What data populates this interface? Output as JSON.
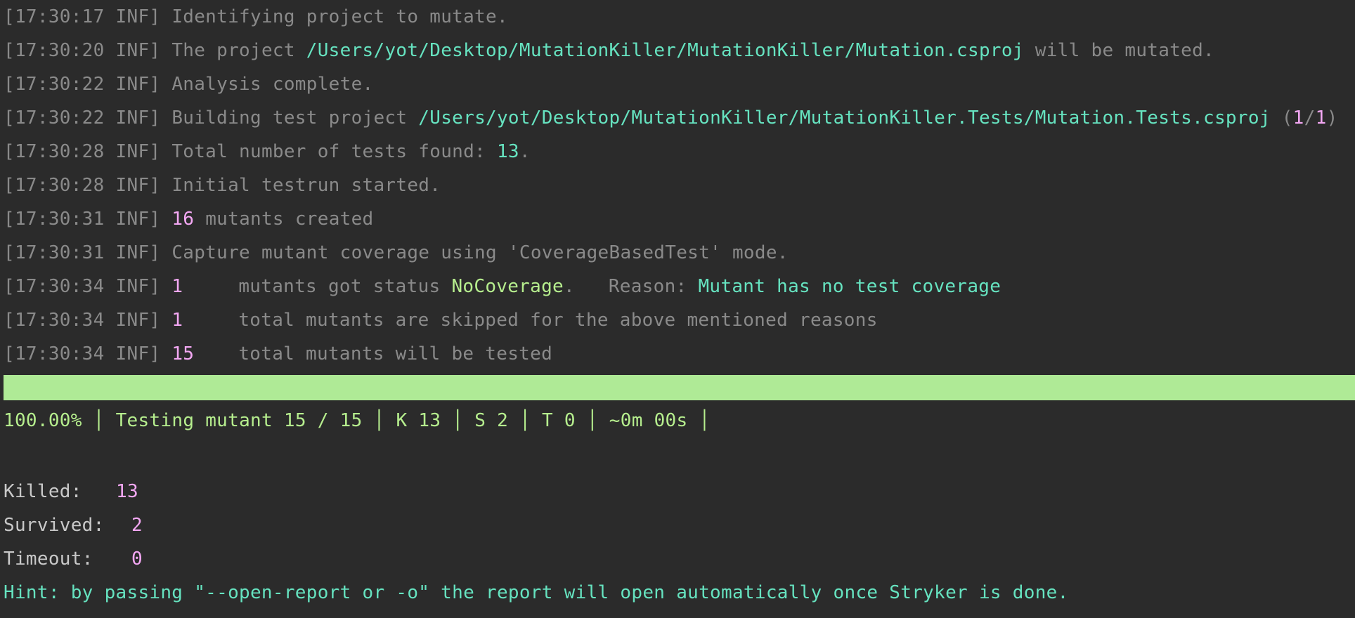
{
  "log": [
    {
      "ts": "[17:30:17 INF]",
      "parts": [
        {
          "t": " Identifying project to mutate.",
          "c": "gray"
        }
      ]
    },
    {
      "ts": "[17:30:20 INF]",
      "parts": [
        {
          "t": " The project ",
          "c": "gray"
        },
        {
          "t": "/Users/yot/Desktop/MutationKiller/MutationKiller/Mutation.csproj",
          "c": "teal"
        },
        {
          "t": " will be mutated.",
          "c": "gray"
        }
      ]
    },
    {
      "ts": "[17:30:22 INF]",
      "parts": [
        {
          "t": " Analysis complete.",
          "c": "gray"
        }
      ]
    },
    {
      "ts": "[17:30:22 INF]",
      "parts": [
        {
          "t": " Building test project ",
          "c": "gray"
        },
        {
          "t": "/Users/yot/Desktop/MutationKiller/MutationKiller.Tests/Mutation.Tests.csproj",
          "c": "teal"
        },
        {
          "t": " (",
          "c": "gray"
        },
        {
          "t": "1",
          "c": "pink"
        },
        {
          "t": "/",
          "c": "gray"
        },
        {
          "t": "1",
          "c": "pink"
        },
        {
          "t": ")",
          "c": "gray"
        }
      ]
    },
    {
      "ts": "[17:30:28 INF]",
      "parts": [
        {
          "t": " Total number of tests found: ",
          "c": "gray"
        },
        {
          "t": "13",
          "c": "teal"
        },
        {
          "t": ".",
          "c": "gray"
        }
      ]
    },
    {
      "ts": "[17:30:28 INF]",
      "parts": [
        {
          "t": " Initial testrun started.",
          "c": "gray"
        }
      ]
    },
    {
      "ts": "[17:30:31 INF]",
      "parts": [
        {
          "t": " ",
          "c": "gray"
        },
        {
          "t": "16",
          "c": "pink"
        },
        {
          "t": " mutants created",
          "c": "gray"
        }
      ]
    },
    {
      "ts": "[17:30:31 INF]",
      "parts": [
        {
          "t": " Capture mutant coverage using 'CoverageBasedTest' mode.",
          "c": "gray"
        }
      ]
    },
    {
      "ts": "[17:30:34 INF]",
      "parts": [
        {
          "t": " ",
          "c": "gray"
        },
        {
          "t": "1",
          "c": "pink",
          "pad": true
        },
        {
          "t": "mutants got status ",
          "c": "gray"
        },
        {
          "t": "NoCoverage",
          "c": "lime"
        },
        {
          "t": ".   Reason: ",
          "c": "gray"
        },
        {
          "t": "Mutant has no test coverage",
          "c": "teal"
        }
      ]
    },
    {
      "ts": "[17:30:34 INF]",
      "parts": [
        {
          "t": " ",
          "c": "gray"
        },
        {
          "t": "1",
          "c": "pink",
          "pad": true
        },
        {
          "t": "total mutants are skipped for the above mentioned reasons",
          "c": "gray"
        }
      ]
    },
    {
      "ts": "[17:30:34 INF]",
      "parts": [
        {
          "t": " ",
          "c": "gray"
        },
        {
          "t": "15",
          "c": "pink",
          "pad": true
        },
        {
          "t": "total mutants will be tested",
          "c": "gray"
        }
      ]
    }
  ],
  "progress": {
    "fraction": 1.0,
    "percent_label": "100.00%",
    "testing_label": "Testing mutant 15 / 15",
    "killed_label": "K 13",
    "survived_label": "S 2",
    "timeout_label": "T 0",
    "eta_label": "~0m 00s",
    "separator": "│"
  },
  "summary": {
    "killed_label": "Killed:",
    "killed_value": "13",
    "survived_label": "Survived:",
    "survived_value": "2",
    "timeout_label": "Timeout:",
    "timeout_value": "0"
  },
  "hint": "Hint: by passing \"--open-report or -o\" the report will open automatically once Stryker is done.",
  "colors": {
    "background": "#2b2b2b",
    "gray": "#8a8a8a",
    "teal": "#66e3c0",
    "pink": "#f4a8f4",
    "lime": "#b6ee8e",
    "progress_fill": "#afea96"
  }
}
